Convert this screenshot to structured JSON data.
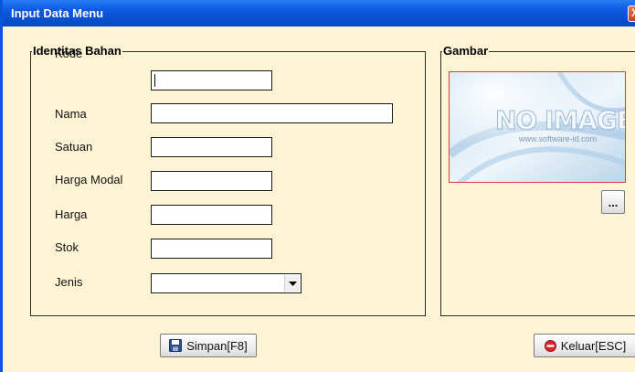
{
  "window": {
    "title": "Input Data Menu",
    "close_label": "X"
  },
  "identitas": {
    "legend": "Identitas Bahan",
    "fields": [
      {
        "label": "Kode",
        "value": ""
      },
      {
        "label": "Nama",
        "value": ""
      },
      {
        "label": "Satuan",
        "value": ""
      },
      {
        "label": "Harga Modal",
        "value": ""
      },
      {
        "label": "Harga",
        "value": ""
      },
      {
        "label": "Stok",
        "value": ""
      },
      {
        "label": "Jenis",
        "value": ""
      }
    ]
  },
  "gambar": {
    "legend": "Gambar",
    "placeholder_text": "NO IMAGE",
    "watermark": "www.software-id.com",
    "browse_label": "..."
  },
  "buttons": {
    "save_label": "Simpan[F8]",
    "exit_label": "Keluar[ESC]"
  },
  "colors": {
    "titlebar": "#0a54d6",
    "panel_bg": "#fdf4d5",
    "image_border": "#e03a3a",
    "exit_icon": "#d9262c"
  },
  "icons": {
    "save": "floppy-disk-icon",
    "exit": "no-entry-icon",
    "dropdown": "chevron-down-icon"
  }
}
